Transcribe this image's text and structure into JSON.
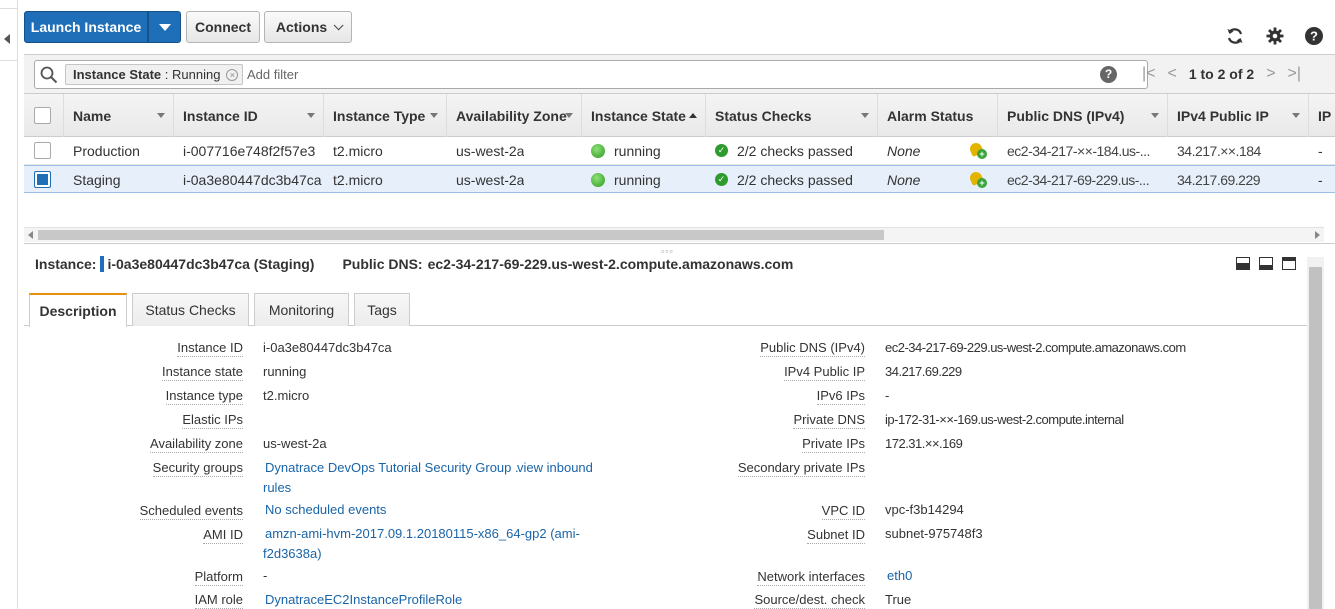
{
  "toolbar": {
    "launch_label": "Launch Instance",
    "connect_label": "Connect",
    "actions_label": "Actions"
  },
  "filter": {
    "token_key": "Instance State",
    "token_sep": " : ",
    "token_value": "Running",
    "placeholder": "Add filter",
    "help": "?",
    "pager_text": "1 to 2 of 2"
  },
  "grid": {
    "columns": [
      "Name",
      "Instance ID",
      "Instance Type",
      "Availability Zone",
      "Instance State",
      "Status Checks",
      "Alarm Status",
      "Public DNS (IPv4)",
      "IPv4 Public IP",
      "IP"
    ],
    "rows": [
      {
        "name": "Production",
        "instance_id": "i-007716e748f2f57e3",
        "type": "t2.micro",
        "az": "us-west-2a",
        "state": "running",
        "checks": "2/2 checks passed",
        "alarm": "None",
        "dns": "ec2-34-217-××-184.us-...",
        "ip": "34.217.××.184",
        "extra": "-",
        "selected": false
      },
      {
        "name": "Staging",
        "instance_id": "i-0a3e80447dc3b47ca",
        "type": "t2.micro",
        "az": "us-west-2a",
        "state": "running",
        "checks": "2/2 checks passed",
        "alarm": "None",
        "dns": "ec2-34-217-69-229.us-...",
        "ip": "34.217.69.229",
        "extra": "-",
        "selected": true
      }
    ]
  },
  "details": {
    "instance_label": "Instance:",
    "instance_value": "i-0a3e80447dc3b47ca (Staging)",
    "dns_label": "Public DNS:",
    "dns_value": "ec2-34-217-69-229.us-west-2.compute.amazonaws.com",
    "tabs": [
      "Description",
      "Status Checks",
      "Monitoring",
      "Tags"
    ],
    "left": [
      {
        "label": "Instance ID",
        "value": "i-0a3e80447dc3b47ca"
      },
      {
        "label": "Instance state",
        "value": "running"
      },
      {
        "label": "Instance type",
        "value": "t2.micro"
      },
      {
        "label": "Elastic IPs",
        "value": ""
      },
      {
        "label": "Availability zone",
        "value": "us-west-2a"
      },
      {
        "label": "Security groups",
        "value": "Dynatrace DevOps Tutorial Security Group .",
        "value2": "view inbound",
        "value3": "rules"
      },
      {
        "label": "Scheduled events",
        "value": "No scheduled events"
      },
      {
        "label": "AMI ID",
        "value": "amzn-ami-hvm-2017.09.1.20180115-x86_64-gp2 (ami-",
        "value2": "f2d3638a)"
      },
      {
        "label": "Platform",
        "value": "-"
      },
      {
        "label": "IAM role",
        "value": "DynatraceEC2InstanceProfileRole"
      }
    ],
    "right": [
      {
        "label": "Public DNS (IPv4)",
        "value": "ec2-34-217-69-229.us-west-2.compute.amazonaws.com"
      },
      {
        "label": "IPv4 Public IP",
        "value": "34.217.69.229"
      },
      {
        "label": "IPv6 IPs",
        "value": "-"
      },
      {
        "label": "Private DNS",
        "value": "ip-172-31-××-169.us-west-2.compute.internal"
      },
      {
        "label": "Private IPs",
        "value": "172.31.××.169"
      },
      {
        "label": "Secondary private IPs",
        "value": ""
      },
      {
        "label": "VPC ID",
        "value": "vpc-f3b14294"
      },
      {
        "label": "Subnet ID",
        "value": "subnet-975748f3"
      },
      {
        "label": "Network interfaces",
        "value": "eth0"
      },
      {
        "label": "Source/dest. check",
        "value": "True"
      }
    ]
  },
  "colors": {
    "primary": "#1f6fb8",
    "link": "#1a64a8",
    "running": "#2b9a1d",
    "active_tab": "#e88f0c"
  }
}
